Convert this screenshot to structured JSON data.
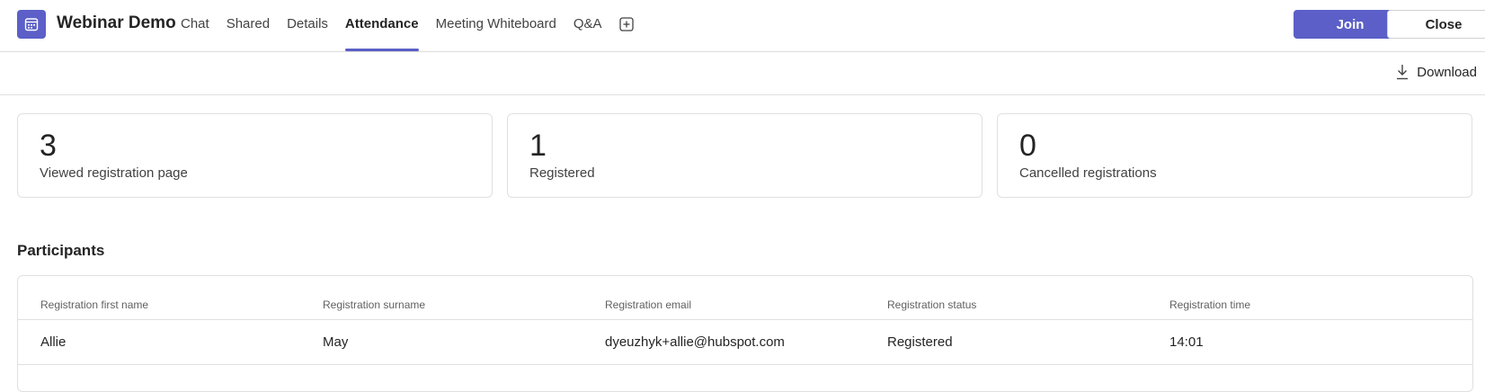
{
  "header": {
    "title": "Webinar Demo",
    "app_icon": "calendar-icon",
    "tabs": [
      {
        "label": "Chat",
        "active": false
      },
      {
        "label": "Shared",
        "active": false
      },
      {
        "label": "Details",
        "active": false
      },
      {
        "label": "Attendance",
        "active": true
      },
      {
        "label": "Meeting Whiteboard",
        "active": false
      },
      {
        "label": "Q&A",
        "active": false
      }
    ],
    "add_tab_icon": "add-tab-icon",
    "join_label": "Join",
    "close_label": "Close"
  },
  "toolbar": {
    "download_label": "Download",
    "download_icon": "download-icon"
  },
  "stats": [
    {
      "value": "3",
      "label": "Viewed registration page"
    },
    {
      "value": "1",
      "label": "Registered"
    },
    {
      "value": "0",
      "label": "Cancelled registrations"
    }
  ],
  "participants": {
    "title": "Participants",
    "columns": [
      "Registration first name",
      "Registration surname",
      "Registration email",
      "Registration status",
      "Registration time"
    ],
    "rows": [
      [
        "Allie",
        "May",
        "dyeuzhyk+allie@hubspot.com",
        "Registered",
        "14:01"
      ]
    ]
  },
  "colors": {
    "accent": "#5b5fc7",
    "border": "#e0e0e0",
    "text": "#242424"
  }
}
